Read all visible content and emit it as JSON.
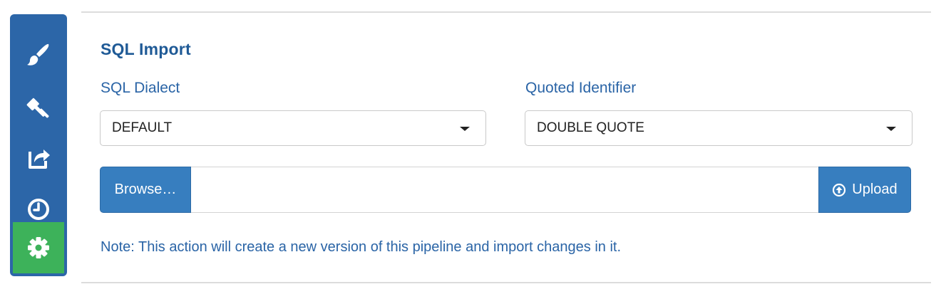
{
  "sidebar": {
    "items": [
      {
        "icon": "paint-brush-icon"
      },
      {
        "icon": "gavel-icon"
      },
      {
        "icon": "share-export-icon"
      },
      {
        "icon": "clock-history-icon"
      },
      {
        "icon": "gear-icon",
        "active": true
      }
    ],
    "background_color": "#2c66a8",
    "active_color": "#3db25a"
  },
  "section": {
    "title": "SQL Import"
  },
  "form": {
    "dialect_label": "SQL Dialect",
    "dialect_value": "DEFAULT",
    "quoted_label": "Quoted Identifier",
    "quoted_value": "DOUBLE QUOTE",
    "browse_label": "Browse…",
    "file_value": "",
    "upload_label": "Upload",
    "upload_icon": "arrow-circle-up-icon"
  },
  "note": "Note: This action will create a new version of this pipeline and import changes in it.",
  "colors": {
    "accent": "#377ebf",
    "title": "#1f5a96",
    "text_link": "#2a64a6"
  }
}
